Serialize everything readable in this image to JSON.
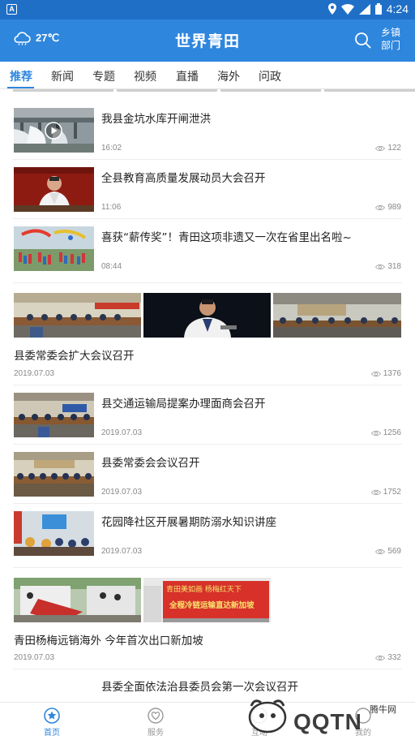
{
  "status_bar": {
    "time": "4:24"
  },
  "header": {
    "weather_temp": "27℃",
    "app_title": "世界青田",
    "township_line1": "乡镇",
    "township_line2": "部门"
  },
  "tabs": [
    {
      "label": "推荐",
      "active": true
    },
    {
      "label": "新闻",
      "active": false
    },
    {
      "label": "专题",
      "active": false
    },
    {
      "label": "视频",
      "active": false
    },
    {
      "label": "直播",
      "active": false
    },
    {
      "label": "海外",
      "active": false
    },
    {
      "label": "问政",
      "active": false
    }
  ],
  "news": [
    {
      "title": "我县金坑水库开闸泄洪",
      "time": "16:02",
      "views": "122",
      "video": true
    },
    {
      "title": "全县教育高质量发展动员大会召开",
      "time": "11:06",
      "views": "989"
    },
    {
      "title": "喜获“薪传奖”！青田这项非遗又一次在省里出名啦~",
      "time": "08:44",
      "views": "318"
    },
    {
      "title": "县委常委会扩大会议召开",
      "time": "2019.07.03",
      "views": "1376"
    },
    {
      "title": "县交通运输局提案办理面商会召开",
      "time": "2019.07.03",
      "views": "1256"
    },
    {
      "title": "县委常委会会议召开",
      "time": "2019.07.03",
      "views": "1752"
    },
    {
      "title": "花园降社区开展暑期防溺水知识讲座",
      "time": "2019.07.03",
      "views": "569"
    },
    {
      "title": "青田杨梅远销海外 今年首次出口新加坡",
      "time": "2019.07.03",
      "views": "332"
    },
    {
      "title": "县委全面依法治县委员会第一次会议召开"
    }
  ],
  "banner_text": {
    "line1": "青田美如画  杨梅红天下",
    "line2": "全程冷链运输直达新加坡"
  },
  "bottom_nav": [
    {
      "label": "首页",
      "active": true
    },
    {
      "label": "服务",
      "active": false
    },
    {
      "label": "互动",
      "active": false
    },
    {
      "label": "我的",
      "active": false
    }
  ],
  "watermark": {
    "brand": "QQTN",
    "site": "腾牛网"
  },
  "colors": {
    "accent": "#2f86dd",
    "status_bar": "#1f6fc7"
  }
}
